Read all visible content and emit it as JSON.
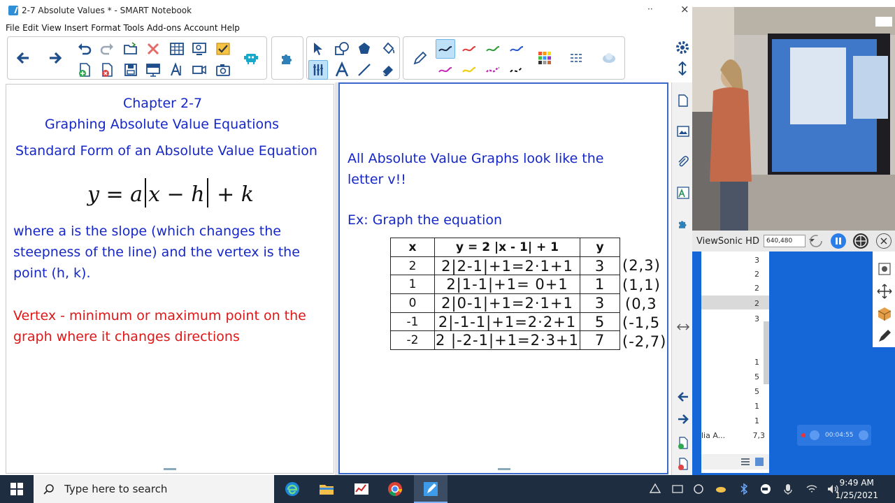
{
  "window": {
    "title": "2-7 Absolute Values * - SMART Notebook",
    "min_glyph": "··",
    "close_glyph": "×"
  },
  "menu": [
    "File",
    "Edit",
    "View",
    "Insert",
    "Format",
    "Tools",
    "Add-ons",
    "Account",
    "Help"
  ],
  "left_page": {
    "heading_line1": "Chapter 2-7",
    "heading_line2": "Graphing Absolute Value Equations",
    "standard_form": "Standard Form of an Absolute Value Equation",
    "equation": {
      "y": "y",
      "eq": " = ",
      "a": "a",
      "x": "x",
      "minus": " − ",
      "h": "h",
      "plus": " + ",
      "k": "k"
    },
    "description": [
      "where a is the slope (which changes the",
      "steepness of the line) and the vertex is the",
      "point (h, k)."
    ],
    "vertex_def": [
      "Vertex - minimum or maximum point on the",
      "graph where it changes directions"
    ]
  },
  "right_page": {
    "intro": [
      "All Absolute Value Graphs look like the",
      "letter v!!"
    ],
    "example": "Ex:  Graph the equation",
    "table": {
      "headers": [
        "x",
        "y = 2 |x - 1| + 1",
        "y"
      ],
      "rows": [
        {
          "x": "2",
          "work": "2|2-1|+1=2·1+1",
          "y": "3",
          "point": "(2,3)"
        },
        {
          "x": "1",
          "work": "2|1-1|+1= 0+1",
          "y": "1",
          "point": "(1,1)"
        },
        {
          "x": "0",
          "work": "2|0-1|+1=2·1+1",
          "y": "3",
          "point": "(0,3"
        },
        {
          "x": "-1",
          "work": "2|-1-1|+1=2·2+1",
          "y": "5",
          "point": "(-1,5"
        },
        {
          "x": "-2",
          "work": "2 |-2-1|+1=2·3+1",
          "y": "7",
          "point": "(-2,7)"
        }
      ]
    }
  },
  "webcam": {
    "device": "ViewSonic HD",
    "resolution": "640,480"
  },
  "explorer_numbers": [
    "3",
    "2",
    "2",
    "2",
    "3",
    "1",
    "5",
    "5",
    "1",
    "1"
  ],
  "explorer_tail": {
    "name": "lia A...",
    "size": "7,3"
  },
  "recording": {
    "time": "00:04:55"
  },
  "taskbar": {
    "search_placeholder": "Type here to search",
    "time": "9:49 AM",
    "date": "1/25/2021"
  },
  "colors": {
    "accent_blue": "#1627c8",
    "vertex_red": "#e01717",
    "page_border": "#3b69c9",
    "taskbar": "#1e2d3f",
    "desktop": "#1566d6"
  }
}
